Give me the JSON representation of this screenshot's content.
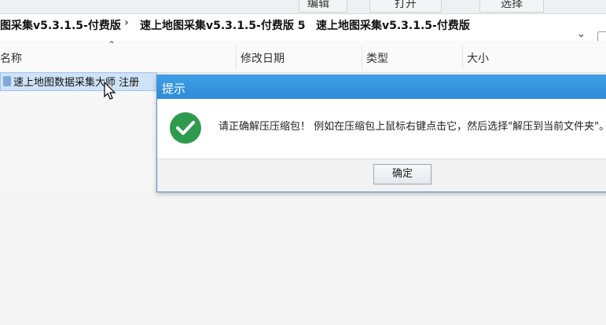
{
  "ribbon": {
    "btn1": "编辑",
    "btn2": "打开",
    "btn3": "选择"
  },
  "address": {
    "crumbs": [
      "图采集v5.3.1.5-付费版",
      "速上地图采集v5.3.1.5-付费版 5",
      "速上地图采集v5.3.1.5-付费版"
    ],
    "separator": "›",
    "dropdown_icon": "chevron-down-icon"
  },
  "columns": {
    "name": "名称",
    "date": "修改日期",
    "type": "类型",
    "size": "大小"
  },
  "files": [
    {
      "name": "速上地图数据采集大师 注册"
    }
  ],
  "dialog": {
    "title": "提示",
    "message": "请正确解压压缩包！ 例如在压缩包上鼠标右键点击它，然后选择\"解压到当前文件夹\"。",
    "ok_label": "确定",
    "icon": "success-check-icon",
    "accent": "#2f8ad8",
    "icon_color": "#2e9a4e"
  }
}
